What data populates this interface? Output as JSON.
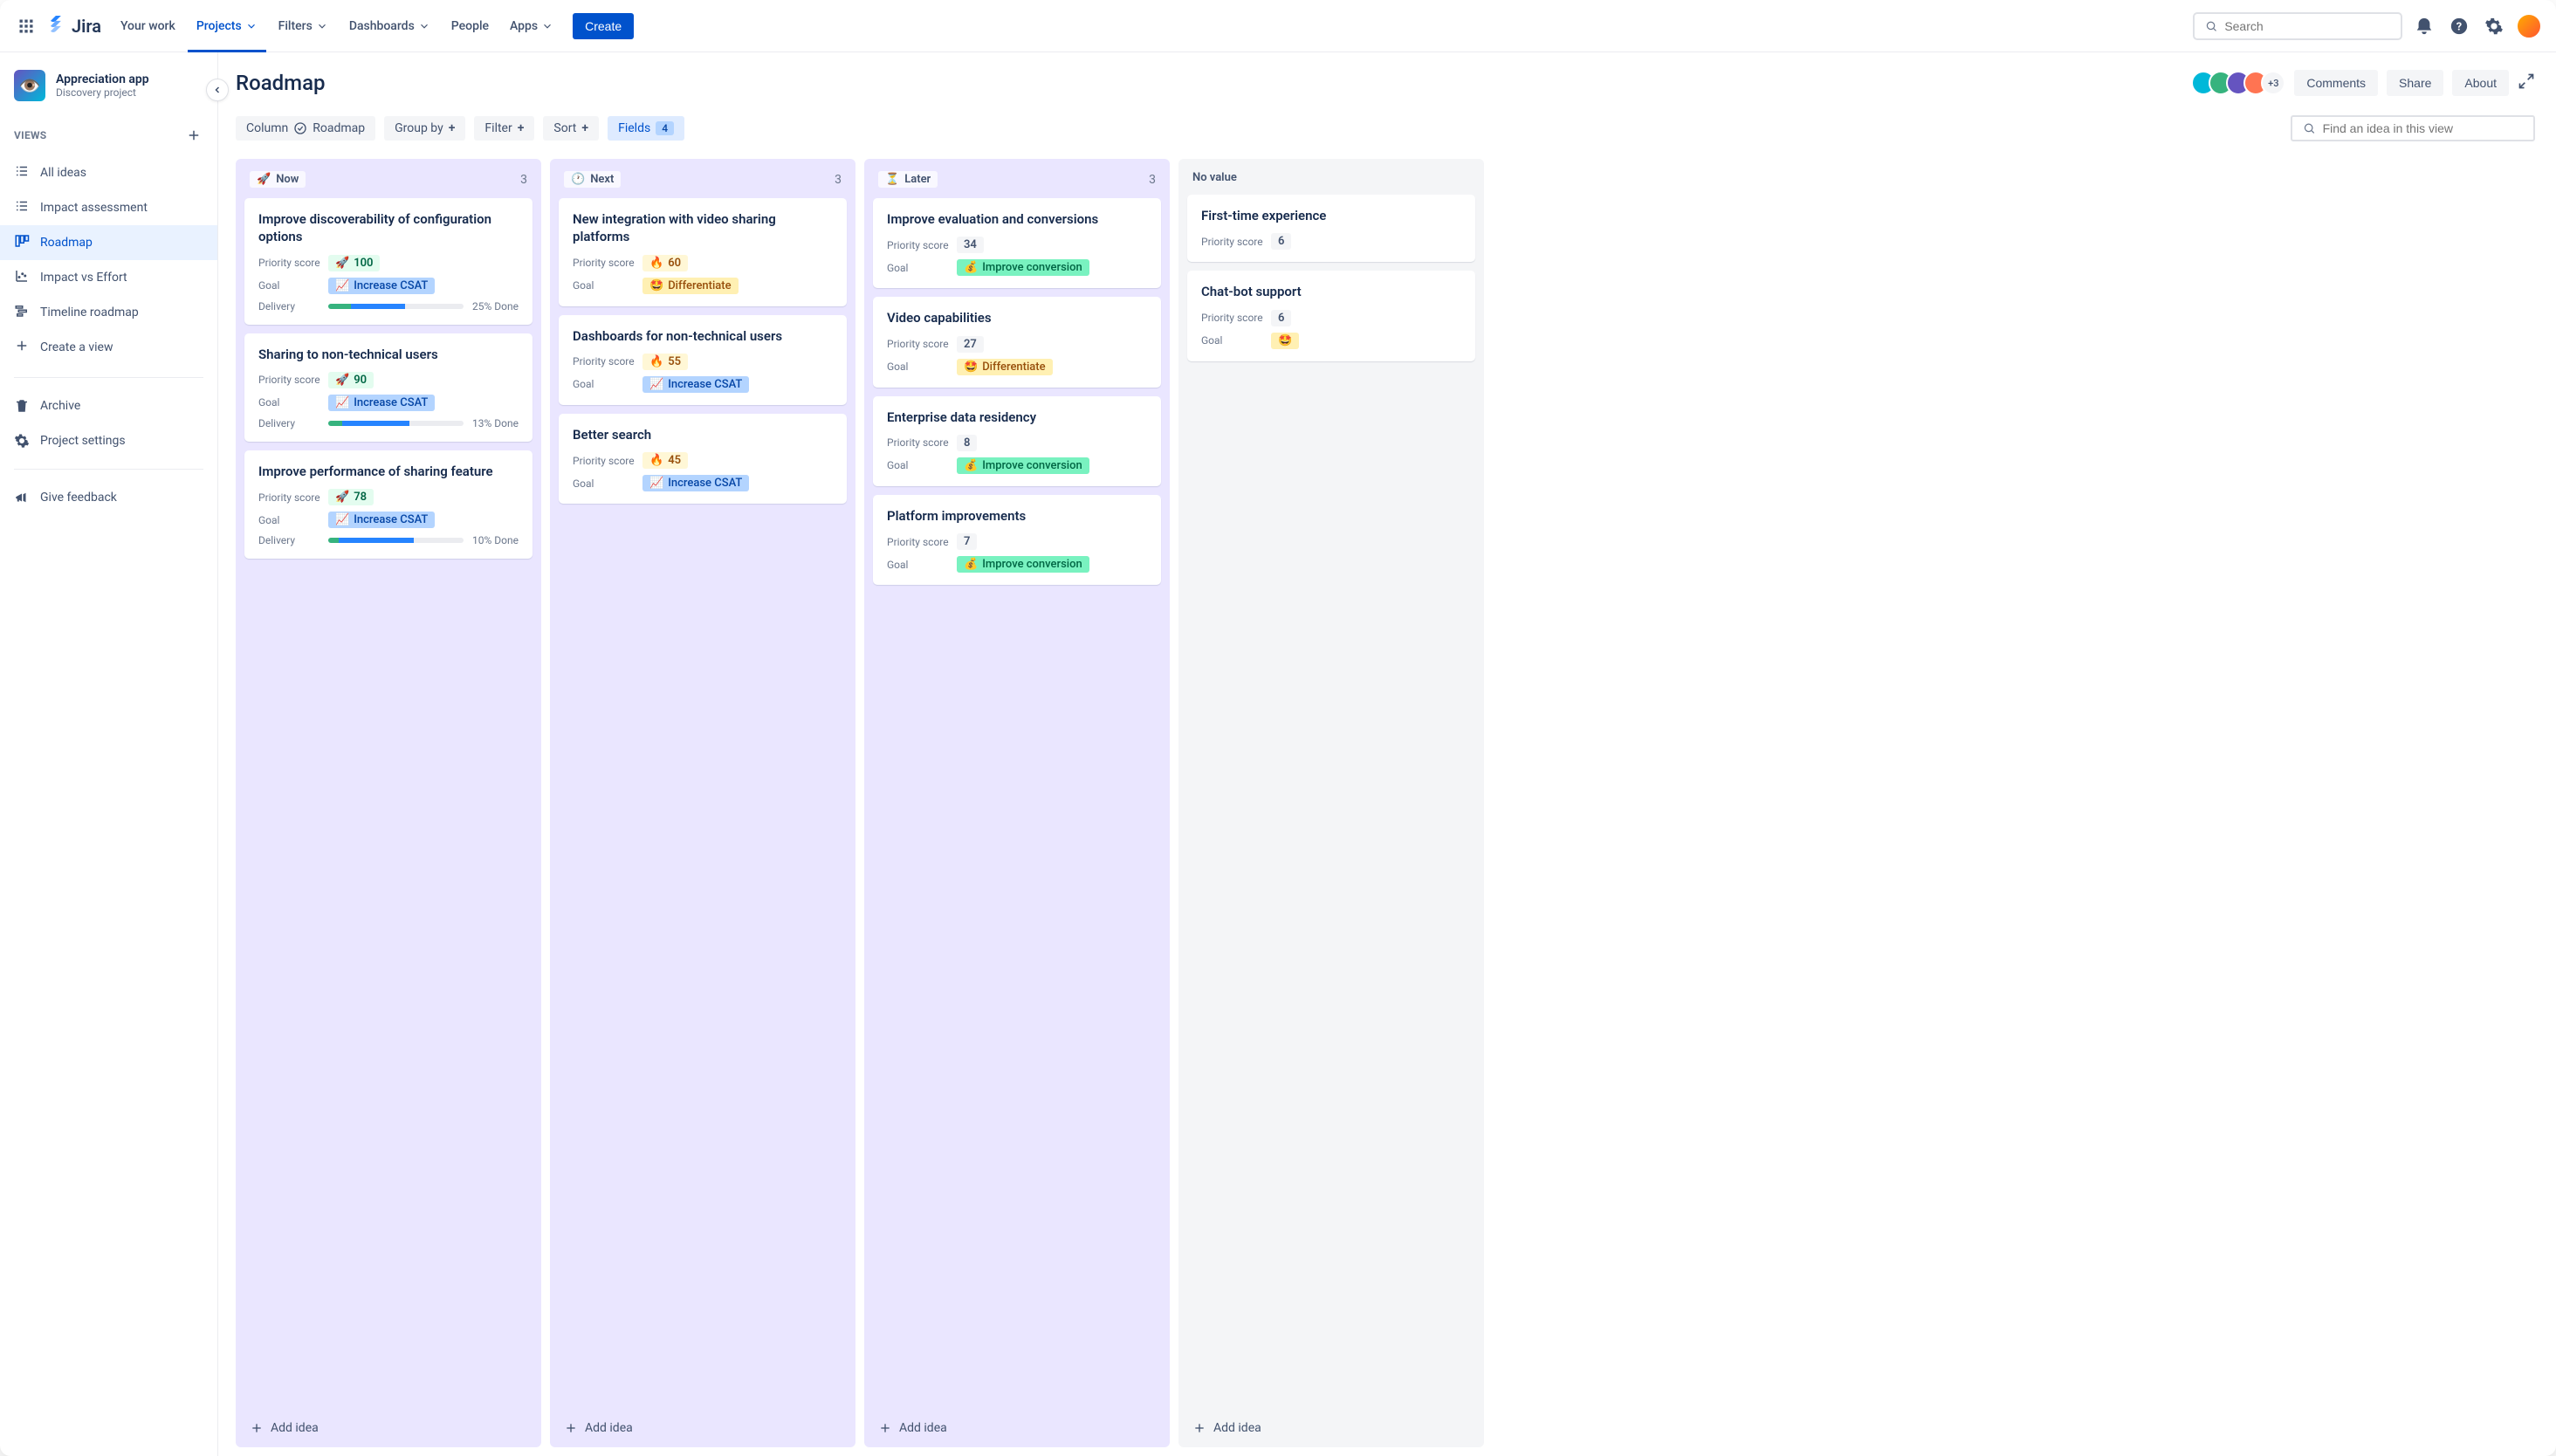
{
  "topnav": {
    "logo_text": "Jira",
    "items": [
      {
        "label": "Your work",
        "dropdown": false
      },
      {
        "label": "Projects",
        "dropdown": true,
        "active": true
      },
      {
        "label": "Filters",
        "dropdown": true
      },
      {
        "label": "Dashboards",
        "dropdown": true
      },
      {
        "label": "People",
        "dropdown": false
      },
      {
        "label": "Apps",
        "dropdown": true
      }
    ],
    "create_label": "Create",
    "search_placeholder": "Search"
  },
  "sidebar": {
    "project_name": "Appreciation app",
    "project_type": "Discovery project",
    "views_label": "VIEWS",
    "views": [
      {
        "icon": "list",
        "label": "All ideas"
      },
      {
        "icon": "list",
        "label": "Impact assessment"
      },
      {
        "icon": "board",
        "label": "Roadmap",
        "selected": true
      },
      {
        "icon": "chart",
        "label": "Impact vs Effort"
      },
      {
        "icon": "timeline",
        "label": "Timeline roadmap"
      },
      {
        "icon": "plus",
        "label": "Create a view"
      }
    ],
    "archive_label": "Archive",
    "settings_label": "Project settings",
    "feedback_label": "Give feedback"
  },
  "page": {
    "title": "Roadmap",
    "avatar_extra": "+3",
    "comments_label": "Comments",
    "share_label": "Share",
    "about_label": "About"
  },
  "toolbar": {
    "column_label": "Column",
    "column_value": "Roadmap",
    "group_label": "Group by",
    "filter_label": "Filter",
    "sort_label": "Sort",
    "fields_label": "Fields",
    "fields_count": "4",
    "find_placeholder": "Find an idea in this view"
  },
  "field_labels": {
    "priority": "Priority score",
    "goal": "Goal",
    "delivery": "Delivery"
  },
  "columns": [
    {
      "emoji": "🚀",
      "name": "Now",
      "count": "3",
      "bg": "purple",
      "cards": [
        {
          "title": "Improve discoverability of configuration options",
          "score": "100",
          "score_emoji": "🚀",
          "score_style": "green",
          "goal": "Increase CSAT",
          "goal_emoji": "📈",
          "goal_style": "blue",
          "delivery": {
            "seg1": 17,
            "seg2": 40,
            "text": "25% Done"
          }
        },
        {
          "title": "Sharing to non-technical users",
          "score": "90",
          "score_emoji": "🚀",
          "score_style": "green",
          "goal": "Increase CSAT",
          "goal_emoji": "📈",
          "goal_style": "blue",
          "delivery": {
            "seg1": 10,
            "seg2": 50,
            "text": "13% Done"
          }
        },
        {
          "title": "Improve performance of sharing feature",
          "score": "78",
          "score_emoji": "🚀",
          "score_style": "green",
          "goal": "Increase CSAT",
          "goal_emoji": "📈",
          "goal_style": "blue",
          "delivery": {
            "seg1": 8,
            "seg2": 55,
            "text": "10% Done"
          }
        }
      ]
    },
    {
      "emoji": "🕐",
      "name": "Next",
      "count": "3",
      "bg": "purple",
      "cards": [
        {
          "title": "New integration with video sharing platforms",
          "score": "60",
          "score_emoji": "🔥",
          "score_style": "yellow",
          "goal": "Differentiate",
          "goal_emoji": "🤩",
          "goal_style": "yellow"
        },
        {
          "title": "Dashboards for non-technical users",
          "score": "55",
          "score_emoji": "🔥",
          "score_style": "yellow",
          "goal": "Increase CSAT",
          "goal_emoji": "📈",
          "goal_style": "blue"
        },
        {
          "title": "Better search",
          "score": "45",
          "score_emoji": "🔥",
          "score_style": "yellow",
          "goal": "Increase CSAT",
          "goal_emoji": "📈",
          "goal_style": "blue"
        }
      ]
    },
    {
      "emoji": "⏳",
      "name": "Later",
      "count": "3",
      "bg": "purple",
      "cards": [
        {
          "title": "Improve evaluation and conversions",
          "score": "34",
          "score_style": "gray",
          "goal": "Improve conversion",
          "goal_emoji": "💰",
          "goal_style": "teal"
        },
        {
          "title": "Video capabilities",
          "score": "27",
          "score_style": "gray",
          "goal": "Differentiate",
          "goal_emoji": "🤩",
          "goal_style": "yellow"
        },
        {
          "title": "Enterprise data residency",
          "score": "8",
          "score_style": "gray",
          "goal": "Improve conversion",
          "goal_emoji": "💰",
          "goal_style": "teal"
        },
        {
          "title": "Platform improvements",
          "score": "7",
          "score_style": "gray",
          "goal": "Improve conversion",
          "goal_emoji": "💰",
          "goal_style": "teal"
        }
      ]
    },
    {
      "name": "No value",
      "bg": "novalue",
      "cards": [
        {
          "title": "First-time experience",
          "score": "6",
          "score_style": "gray"
        },
        {
          "title": "Chat-bot support",
          "score": "6",
          "score_style": "gray",
          "goal": "",
          "goal_emoji": "🤩"
        }
      ]
    }
  ],
  "add_idea_label": "Add idea"
}
